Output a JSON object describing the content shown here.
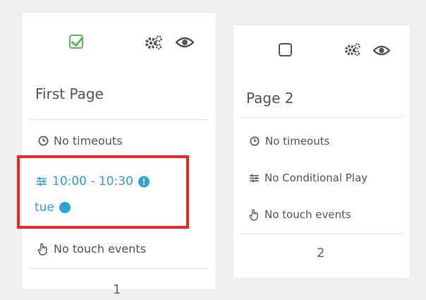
{
  "pages": [
    {
      "title": "First Page",
      "checked": true,
      "timeouts": "No timeouts",
      "conditional_time": "10:00 - 10:30",
      "conditional_day": "tue",
      "touch": "No touch events",
      "number": "1"
    },
    {
      "title": "Page 2",
      "checked": false,
      "timeouts": "No timeouts",
      "conditional": "No Conditional Play",
      "touch": "No touch events",
      "number": "2"
    }
  ],
  "colors": {
    "accent_blue": "#2aa3d8",
    "check_green": "#5cb85c",
    "highlight_red": "#e82a1f"
  },
  "icons": [
    "menu-icon",
    "checkbox-icon",
    "settings-icon",
    "eye-icon",
    "clock-icon",
    "sliders-icon",
    "info-icon",
    "verified-check-icon",
    "hand-pointer-icon"
  ]
}
